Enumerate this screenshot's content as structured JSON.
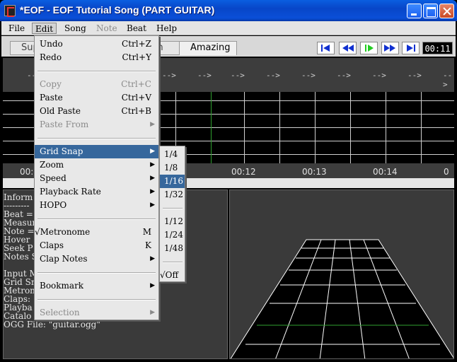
{
  "window": {
    "title": "*EOF - EOF Tutorial Song (PART GUITAR)"
  },
  "menubar": {
    "file": "File",
    "edit": "Edit",
    "song": "Song",
    "note": "Note",
    "beat": "Beat",
    "help": "Help"
  },
  "tabs": {
    "supreme": "Sup",
    "medium": "m",
    "amazing": "Amazing"
  },
  "playback": {
    "clock": "00:11"
  },
  "editor": {
    "arrow": "-->",
    "times": [
      "00:",
      "00:12",
      "00:13",
      "00:14",
      "0"
    ]
  },
  "info": {
    "lines": [
      "Inform",
      "---------",
      "Beat =",
      "Measur",
      "Note =",
      "Hover",
      "Seek P",
      "Notes S",
      "",
      "Input M",
      "Grid Sn",
      "Metron",
      "Claps:",
      "Playba",
      "Catalo",
      "OGG File: \"guitar.ogg\""
    ]
  },
  "edit_menu": {
    "undo": "Undo",
    "undo_sc": "Ctrl+Z",
    "redo": "Redo",
    "redo_sc": "Ctrl+Y",
    "copy": "Copy",
    "copy_sc": "Ctrl+C",
    "paste": "Paste",
    "paste_sc": "Ctrl+V",
    "old_paste": "Old Paste",
    "old_paste_sc": "Ctrl+B",
    "paste_from": "Paste From",
    "grid_snap": "Grid Snap",
    "zoom": "Zoom",
    "speed": "Speed",
    "playback_rate": "Playback Rate",
    "hopo": "HOPO",
    "metronome": "√Metronome",
    "metronome_sc": "M",
    "claps": "Claps",
    "claps_sc": "K",
    "clap_notes": "Clap Notes",
    "bookmark": "Bookmark",
    "selection": "Selection",
    "submenu_arrow": "▶"
  },
  "snap_menu": {
    "items": [
      "1/4",
      "1/8",
      "1/16",
      "1/32",
      "1/12",
      "1/24",
      "1/48",
      "√Off"
    ]
  },
  "colors": {
    "accent": "#36679c",
    "titlebar": "#0a5ee0",
    "cursor_line": "#2fa02f",
    "play_green": "#22cc22"
  }
}
